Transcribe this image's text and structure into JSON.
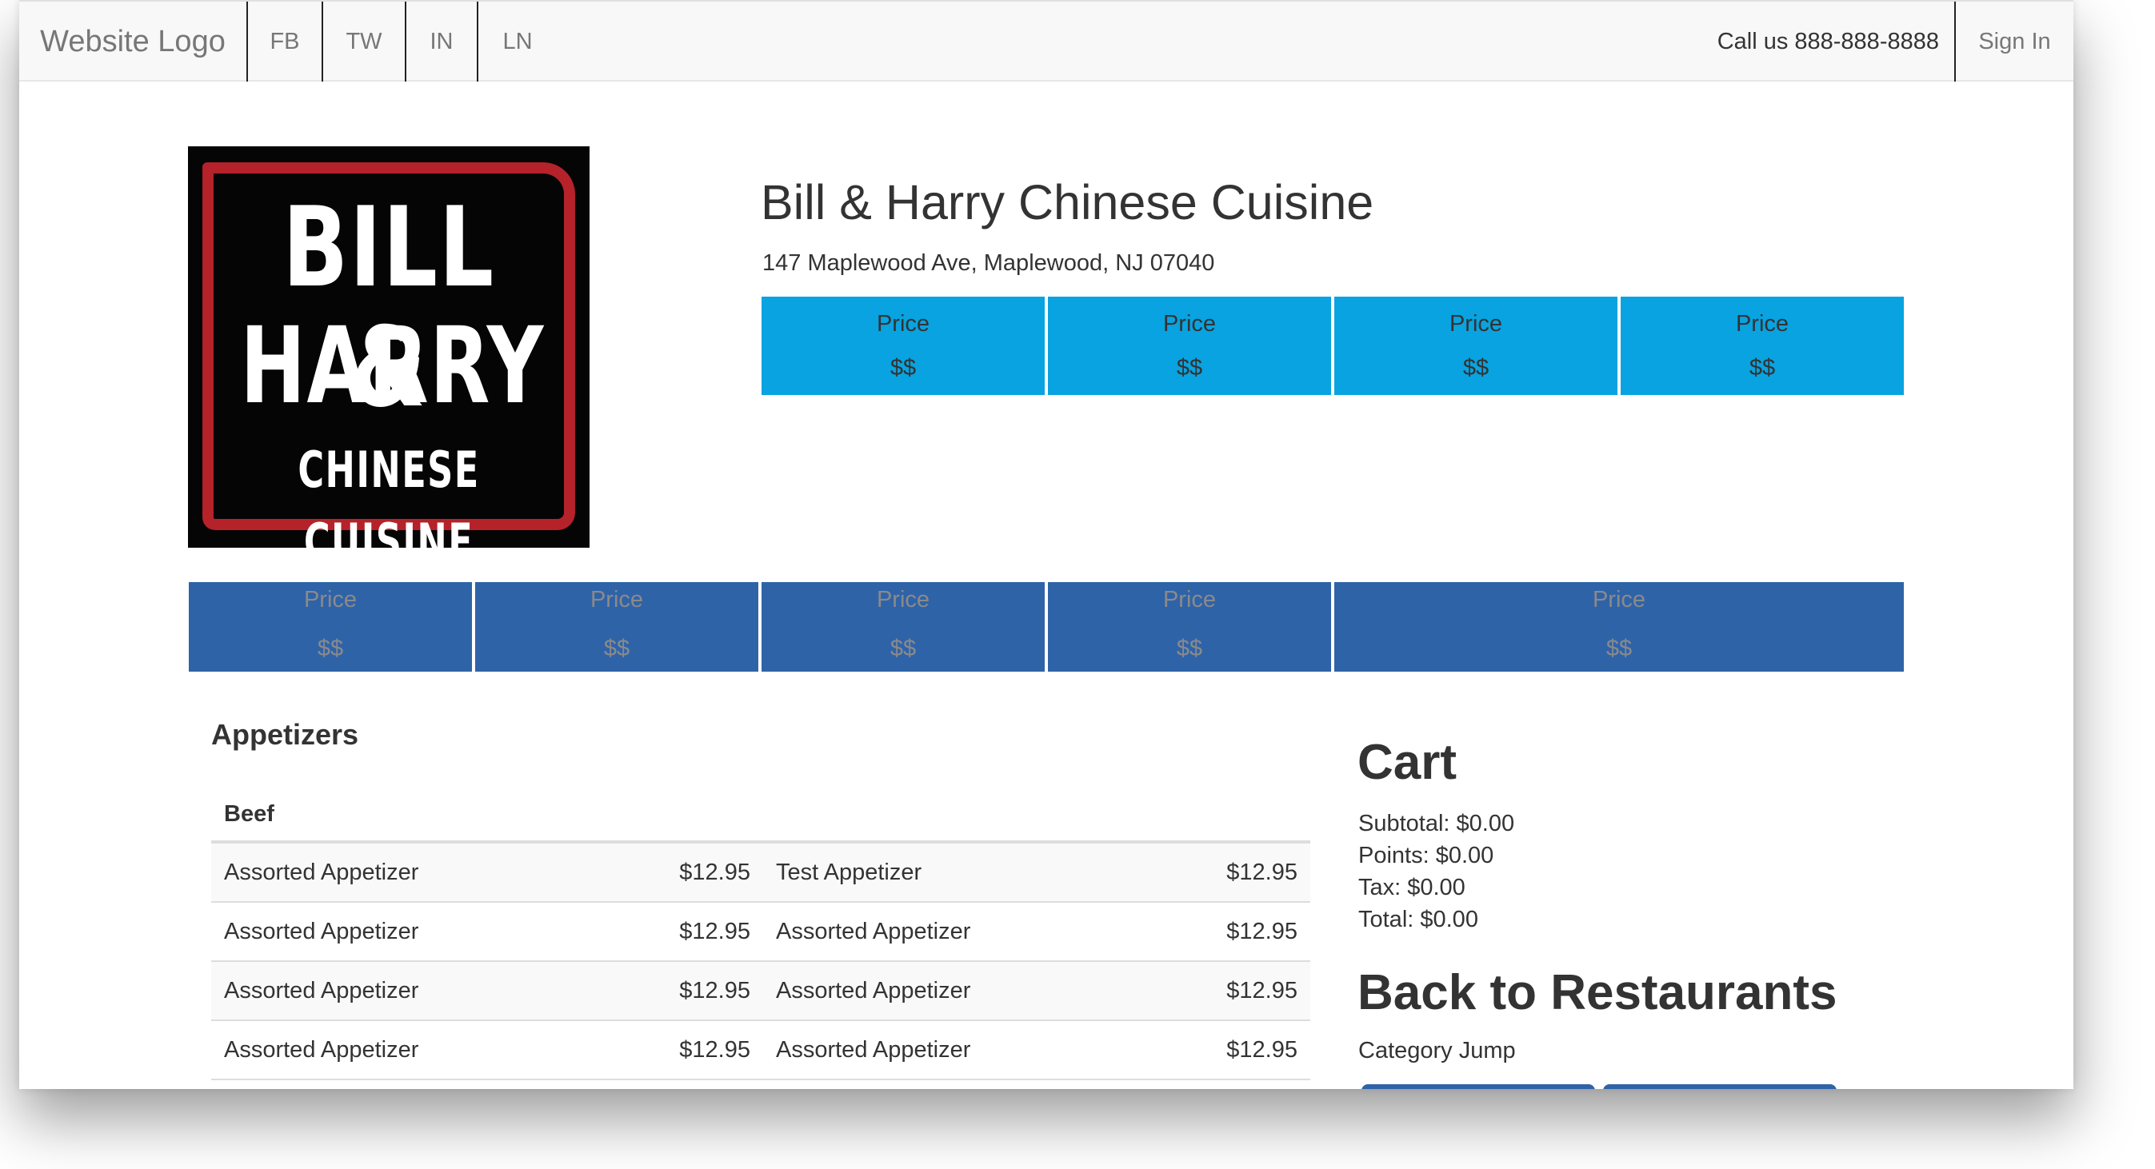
{
  "nav": {
    "brand": "Website Logo",
    "social": [
      "FB",
      "TW",
      "IN",
      "LN"
    ],
    "call": "Call us 888-888-8888",
    "signin": "Sign In"
  },
  "restaurant": {
    "logo_lines": [
      "BILL &",
      "HARRY",
      "CHINESE CUISINE"
    ],
    "name": "Bill & Harry Chinese Cuisine",
    "address": "147 Maplewood Ave, Maplewood, NJ 07040"
  },
  "price_tiles_top": [
    {
      "label": "Price",
      "value": "$$"
    },
    {
      "label": "Price",
      "value": "$$"
    },
    {
      "label": "Price",
      "value": "$$"
    },
    {
      "label": "Price",
      "value": "$$"
    }
  ],
  "price_tiles_bottom": [
    {
      "label": "Price",
      "value": "$$"
    },
    {
      "label": "Price",
      "value": "$$"
    },
    {
      "label": "Price",
      "value": "$$"
    },
    {
      "label": "Price",
      "value": "$$"
    },
    {
      "label": "Price",
      "value": "$$"
    }
  ],
  "menu": {
    "section": "Appetizers",
    "category": "Beef",
    "rows": [
      {
        "name1": "Assorted Appetizer",
        "price1": "$12.95",
        "name2": "Test Appetizer",
        "price2": "$12.95"
      },
      {
        "name1": "Assorted Appetizer",
        "price1": "$12.95",
        "name2": "Assorted Appetizer",
        "price2": "$12.95"
      },
      {
        "name1": "Assorted Appetizer",
        "price1": "$12.95",
        "name2": "Assorted Appetizer",
        "price2": "$12.95"
      },
      {
        "name1": "Assorted Appetizer",
        "price1": "$12.95",
        "name2": "Assorted Appetizer",
        "price2": "$12.95"
      }
    ]
  },
  "cart": {
    "title": "Cart",
    "subtotal": "Subtotal: $0.00",
    "points": "Points: $0.00",
    "tax": "Tax: $0.00",
    "total": "Total: $0.00",
    "back": "Back to Restaurants",
    "category_jump": "Category Jump"
  },
  "colors": {
    "top_tiles": "#08a3e0",
    "bottom_tiles": "#2f63a8",
    "logo_red": "#b5222a"
  }
}
